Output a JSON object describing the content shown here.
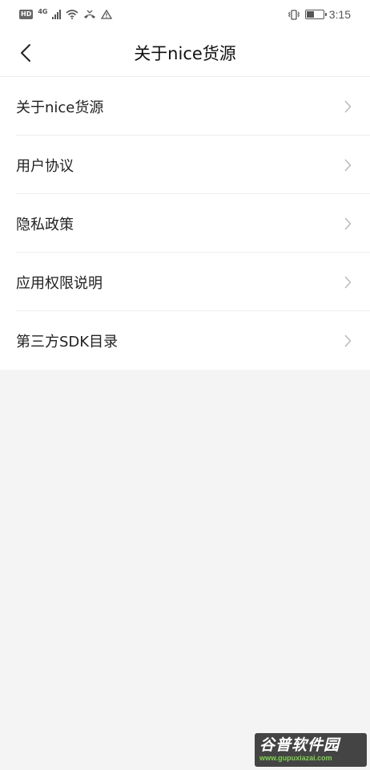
{
  "status_bar": {
    "hd": "HD",
    "network": "4G",
    "time": "3:15",
    "battery_level": 0.45
  },
  "header": {
    "title": "关于nice货源"
  },
  "menu": {
    "items": [
      {
        "label": "关于nice货源"
      },
      {
        "label": "用户协议"
      },
      {
        "label": "隐私政策"
      },
      {
        "label": "应用权限说明"
      },
      {
        "label": "第三方SDK目录"
      }
    ]
  },
  "watermark": {
    "title": "谷普软件园",
    "url": "www.gupuxiazai.com"
  },
  "icons": {
    "back": "back-arrow-icon",
    "chevron": "chevron-right-icon"
  },
  "colors": {
    "background": "#f4f4f4",
    "surface": "#ffffff",
    "chevron": "#bbbbbb",
    "watermark_url": "#7fd34f"
  }
}
